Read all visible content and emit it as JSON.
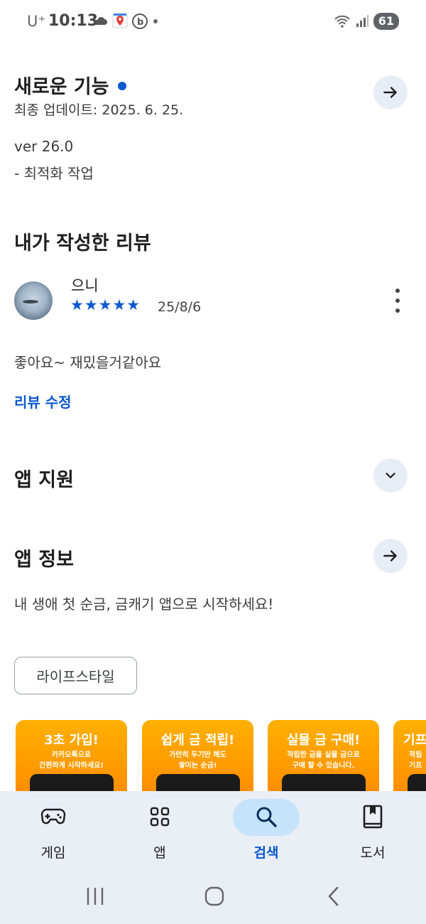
{
  "status_bar": {
    "carrier": "U⁺",
    "time": "10:13",
    "battery": "61"
  },
  "whats_new": {
    "title": "새로운 기능",
    "updated": "최종 업데이트: 2025. 6. 25.",
    "version": "ver 26.0",
    "note": "- 최적화 작업"
  },
  "my_review": {
    "title": "내가 작성한 리뷰",
    "reviewer": "으니",
    "stars": "★★★★★",
    "rating": 5,
    "date": "25/8/6",
    "text": "좋아요~ 재밌을거같아요",
    "edit_label": "리뷰 수정"
  },
  "app_support": {
    "title": "앱 지원"
  },
  "app_info": {
    "title": "앱 정보",
    "description": "내 생애 첫 순금, 금캐기 앱으로 시작하세요!",
    "category_chip": "라이프스타일"
  },
  "screenshots": [
    {
      "title": "3초 가입!",
      "line1": "카카오톡으로",
      "line2": "간편하게 시작하세요!"
    },
    {
      "title": "쉽게 금 적립!",
      "line1": "가만히 두기만 해도",
      "line2": "쌓이는 순금!"
    },
    {
      "title": "실물 금 구매!",
      "line1": "적립한 금을 실물 금으로",
      "line2": "구매 할 수 있습니다."
    },
    {
      "title": "기프",
      "line1": "적립",
      "line2": "기프"
    }
  ],
  "bottom_nav": {
    "items": [
      {
        "label": "게임",
        "icon": "gamepad-icon"
      },
      {
        "label": "앱",
        "icon": "apps-grid-icon"
      },
      {
        "label": "검색",
        "icon": "search-icon",
        "active": true
      },
      {
        "label": "도서",
        "icon": "book-icon"
      }
    ]
  },
  "colors": {
    "accent": "#0b57d0",
    "button_bg": "#e8edf5",
    "nav_bg": "#eaeef5",
    "active_pill": "#c5e4fb",
    "screenshot_orange": "#ff9a00"
  }
}
